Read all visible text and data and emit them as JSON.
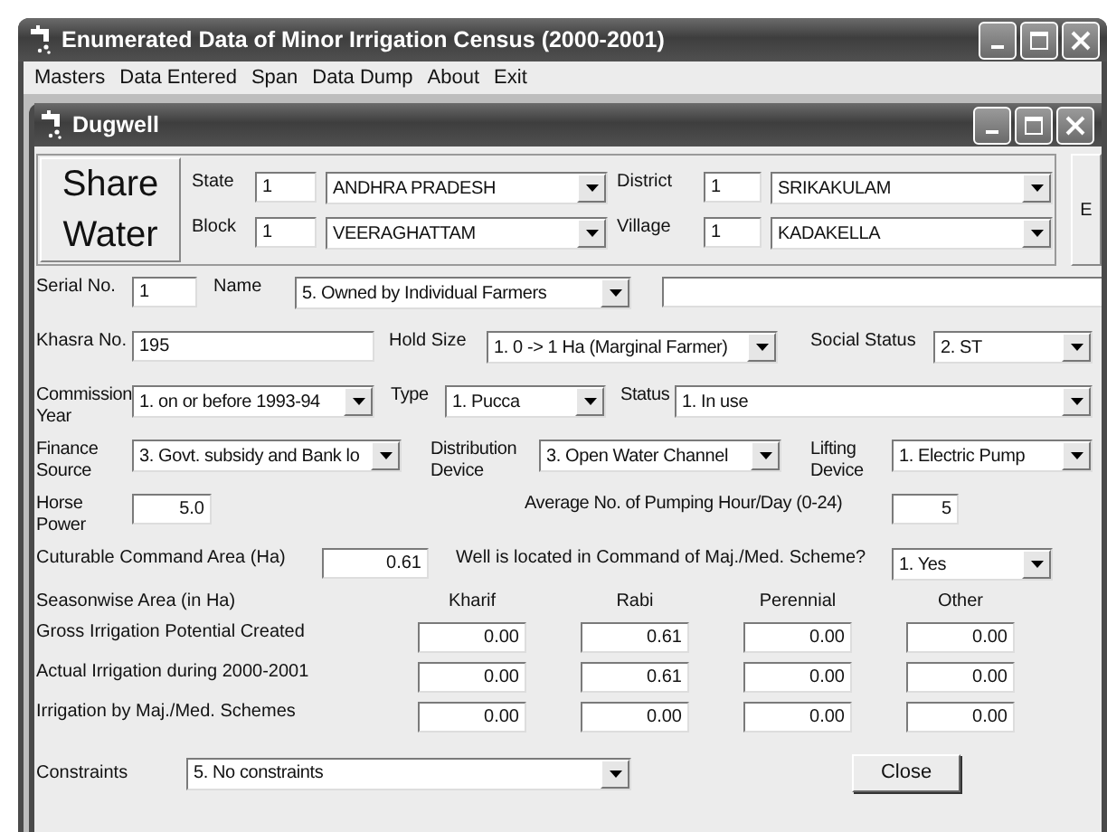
{
  "window": {
    "title": "Enumerated Data of Minor Irrigation Census (2000-2001)"
  },
  "menu": [
    "Masters",
    "Data Entered",
    "Span",
    "Data Dump",
    "About",
    "Exit"
  ],
  "child_window": {
    "title": "Dugwell"
  },
  "logo": {
    "line_1": "Share",
    "line_2": "Water"
  },
  "location": [
    {
      "label": "State",
      "code": "1",
      "value": "ANDHRA PRADESH"
    },
    {
      "label": "District",
      "code": "1",
      "value": "SRIKAKULAM"
    },
    {
      "label": "Block",
      "code": "1",
      "value": "VEERAGHATTAM"
    },
    {
      "label": "Village",
      "code": "1",
      "value": "KADAKELLA"
    }
  ],
  "side_button": "E",
  "form_rows": [
    [
      {
        "kind": "label",
        "text": "Serial No."
      },
      {
        "kind": "text",
        "value": "1"
      },
      {
        "kind": "label",
        "text": "Name"
      },
      {
        "kind": "combo",
        "value": "5. Owned by Individual Farmers"
      },
      {
        "kind": "text"
      }
    ],
    [
      {
        "kind": "label",
        "text": "Khasra No."
      },
      {
        "kind": "text",
        "value": "195"
      },
      {
        "kind": "label",
        "text": "Hold Size"
      },
      {
        "kind": "combo",
        "value": "1. 0 -> 1  Ha (Marginal Farmer)"
      },
      {
        "kind": "label",
        "text": "Social Status"
      },
      {
        "kind": "combo",
        "value": "2. ST"
      }
    ],
    [
      {
        "kind": "label",
        "text": "Commission Year"
      },
      {
        "kind": "combo",
        "value": "1. on or before 1993-94"
      },
      {
        "kind": "label",
        "text": "Type"
      },
      {
        "kind": "combo",
        "value": "1. Pucca"
      },
      {
        "kind": "label",
        "text": "Status"
      },
      {
        "kind": "combo",
        "value": "1. In use"
      }
    ],
    [
      {
        "kind": "label",
        "text": "Finance Source"
      },
      {
        "kind": "combo",
        "value": "3. Govt. subsidy and Bank lo"
      },
      {
        "kind": "label",
        "text": "Distribution Device"
      },
      {
        "kind": "combo",
        "value": "3. Open Water Channel"
      },
      {
        "kind": "label",
        "text": "Lifting Device"
      },
      {
        "kind": "combo",
        "value": "1. Electric Pump"
      }
    ],
    [
      {
        "kind": "label",
        "text": "Horse Power"
      },
      {
        "kind": "number",
        "value": "5.0"
      },
      {
        "kind": "label",
        "text": "Average No. of Pumping Hour/Day (0-24)"
      },
      {
        "kind": "number",
        "value": "5"
      }
    ],
    [
      {
        "kind": "label",
        "text": "Cuturable Command Area  (Ha)"
      },
      {
        "kind": "number",
        "value": "0.61"
      },
      {
        "kind": "label",
        "text": "Well is located in Command of Maj./Med. Scheme?"
      },
      {
        "kind": "combo",
        "value": "1. Yes"
      }
    ]
  ],
  "seasonwise": {
    "title": "Seasonwise Area (in Ha)",
    "columns": [
      "Kharif",
      "Rabi",
      "Perennial",
      "Other"
    ],
    "rows": [
      {
        "label": "Gross Irrigation Potential Created",
        "values": [
          "0.00",
          "0.61",
          "0.00",
          "0.00"
        ]
      },
      {
        "label": "Actual Irrigation during 2000-2001",
        "values": [
          "0.00",
          "0.61",
          "0.00",
          "0.00"
        ]
      },
      {
        "label": "Irrigation by Maj./Med. Schemes",
        "values": [
          "0.00",
          "0.00",
          "0.00",
          "0.00"
        ]
      }
    ]
  },
  "constraints": {
    "label": "Constraints",
    "value": "5. No constraints"
  },
  "close_button": "Close"
}
